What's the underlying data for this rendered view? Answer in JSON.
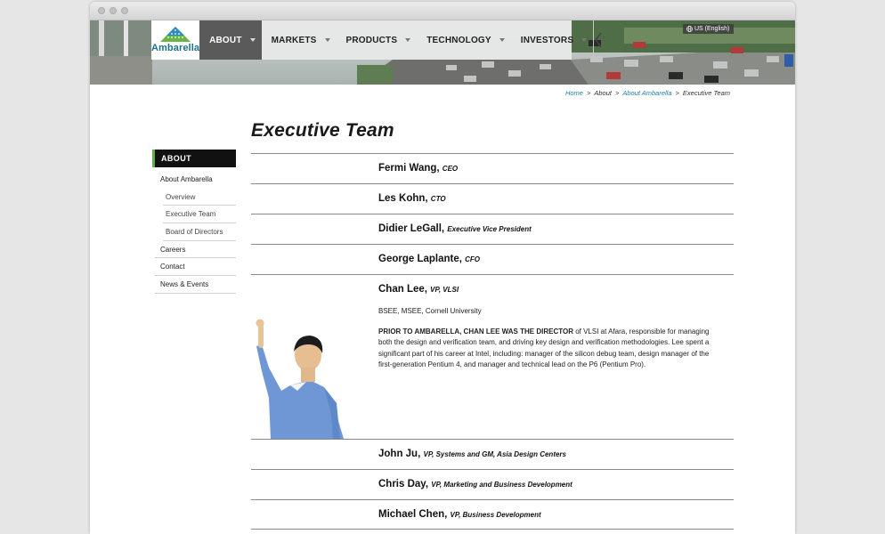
{
  "header": {
    "logo_text": "Ambarella",
    "nav": [
      {
        "label": "ABOUT",
        "active": true
      },
      {
        "label": "MARKETS",
        "active": false
      },
      {
        "label": "PRODUCTS",
        "active": false
      },
      {
        "label": "TECHNOLOGY",
        "active": false
      },
      {
        "label": "INVESTORS",
        "active": false
      }
    ],
    "language": "US (English)"
  },
  "breadcrumb": {
    "home": "Home",
    "about": "About",
    "about_ambarella": "About Ambarella",
    "current": "Executive Team",
    "separator": ">"
  },
  "sidebar": {
    "heading": "ABOUT",
    "items": [
      {
        "label": "About Ambarella",
        "level": 1
      },
      {
        "label": "Overview",
        "level": 2
      },
      {
        "label": "Executive Team",
        "level": 2
      },
      {
        "label": "Board of Directors",
        "level": 2
      },
      {
        "label": "Careers",
        "level": 1
      },
      {
        "label": "Contact",
        "level": 1
      },
      {
        "label": "News & Events",
        "level": 1
      }
    ]
  },
  "page": {
    "title": "Executive Team",
    "executives": [
      {
        "name": "Fermi Wang,",
        "title": "CEO"
      },
      {
        "name": "Les Kohn,",
        "title": "CTO"
      },
      {
        "name": "Didier LeGall,",
        "title": "Executive Vice President"
      },
      {
        "name": "George Laplante,",
        "title": "CFO"
      },
      {
        "name": "Chan Lee,",
        "title": "VP, VLSI",
        "degree": "BSEE, MSEE, Cornell University",
        "bio_lead": "PRIOR TO AMBARELLA, CHAN LEE WAS THE DIRECTOR",
        "bio_rest": " of VLSI at Afara, responsible for managing both the design and verification team, and driving key design and verification methodologies. Lee spent a significant part of his career at Intel, including: manager of the silicon debug team, design manager of the first-generation Pentium 4, and manager and technical lead on the P6 (Pentium Pro)."
      },
      {
        "name": "John Ju,",
        "title": "VP, Systems and GM, Asia Design Centers"
      },
      {
        "name": "Chris Day,",
        "title": "VP, Marketing and Business Development"
      },
      {
        "name": "Michael Chen,",
        "title": "VP, Business Development"
      }
    ]
  },
  "colors": {
    "accent_green": "#5db14c",
    "link_blue": "#1b7fb3",
    "logo_blue": "#1f6f8e",
    "nav_active_bg": "#5a5a5a",
    "sidebar_head_bg": "#111111"
  }
}
